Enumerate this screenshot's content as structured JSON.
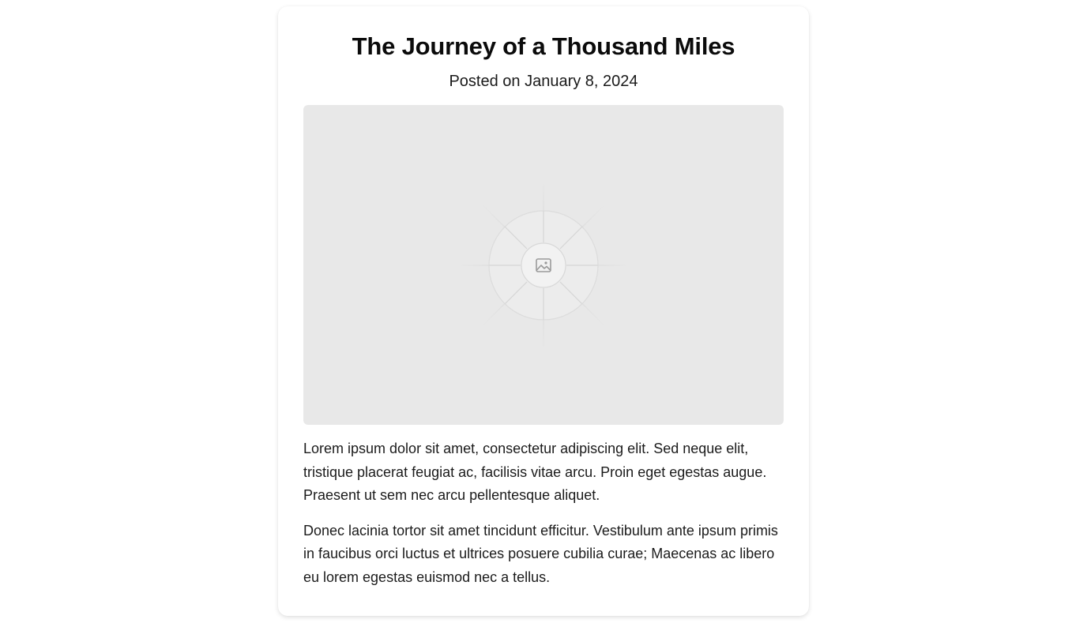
{
  "post": {
    "title": "The Journey of a Thousand Miles",
    "date": "Posted on January 8, 2024",
    "image_icon": "image-placeholder-icon",
    "paragraphs": [
      "Lorem ipsum dolor sit amet, consectetur adipiscing elit. Sed neque elit, tristique placerat feugiat ac, facilisis vitae arcu. Proin eget egestas augue. Praesent ut sem nec arcu pellentesque aliquet.",
      "Donec lacinia tortor sit amet tincidunt efficitur. Vestibulum ante ipsum primis in faucibus orci luctus et ultrices posuere cubilia curae; Maecenas ac libero eu lorem egestas euismod nec a tellus."
    ]
  },
  "colors": {
    "background": "#ffffff",
    "card": "#ffffff",
    "image_placeholder": "#e8e8e8",
    "text": "#111111"
  }
}
